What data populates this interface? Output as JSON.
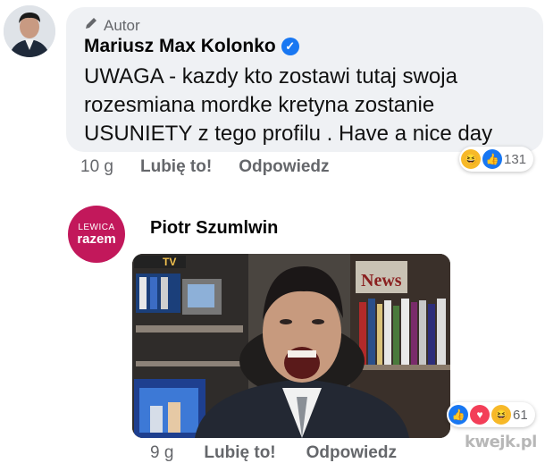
{
  "comment1": {
    "badge": "Autor",
    "author": "Mariusz Max Kolonko",
    "text": "UWAGA - kazdy kto zostawi tutaj swoja rozesmiana mordke kretyna zostanie USUNIETY z tego profilu . Have a nice day",
    "time": "10 g",
    "like_label": "Lubię to!",
    "reply_label": "Odpowiedz",
    "reactions": {
      "icons": [
        "haha-icon",
        "like-icon"
      ],
      "count": "131"
    }
  },
  "comment2": {
    "avatar_line1": "LEWICA",
    "avatar_line2": "razem",
    "author": "Piotr Szumlwin",
    "image": {
      "sign_text": "News",
      "logo_text": "TV"
    },
    "time": "9 g",
    "like_label": "Lubię to!",
    "reply_label": "Odpowiedz",
    "reactions": {
      "icons": [
        "like-icon",
        "love-icon",
        "haha-icon"
      ],
      "count": "61"
    }
  },
  "watermark": "kwejk.pl",
  "colors": {
    "bubble": "#eff1f4",
    "meta_text": "#65676b",
    "verified": "#1877f2",
    "party": "#c2185b"
  }
}
